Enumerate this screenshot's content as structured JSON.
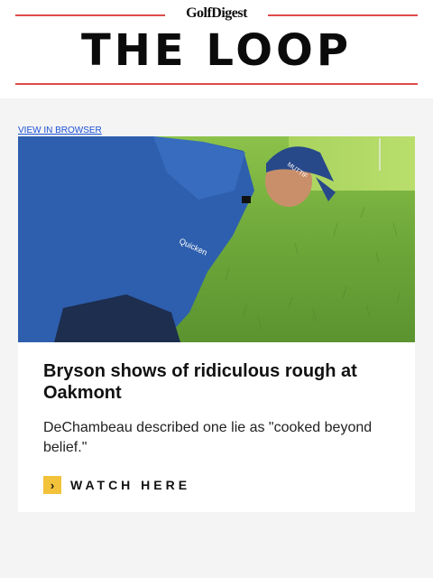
{
  "header": {
    "brand": "GolfDigest",
    "masthead": "THE LOOP",
    "accent_color": "#e04a4a"
  },
  "view_in_browser": "VIEW IN BROWSER",
  "article": {
    "image_alt": "Golfer in blue examining thick rough",
    "title": "Bryson shows of ridiculous rough at Oakmont",
    "description": "DeChambeau described one lie as \"cooked beyond belief.\"",
    "cta_icon": "chevron-right-icon",
    "cta_label": "WATCH HERE",
    "cta_color": "#f2c23a"
  }
}
